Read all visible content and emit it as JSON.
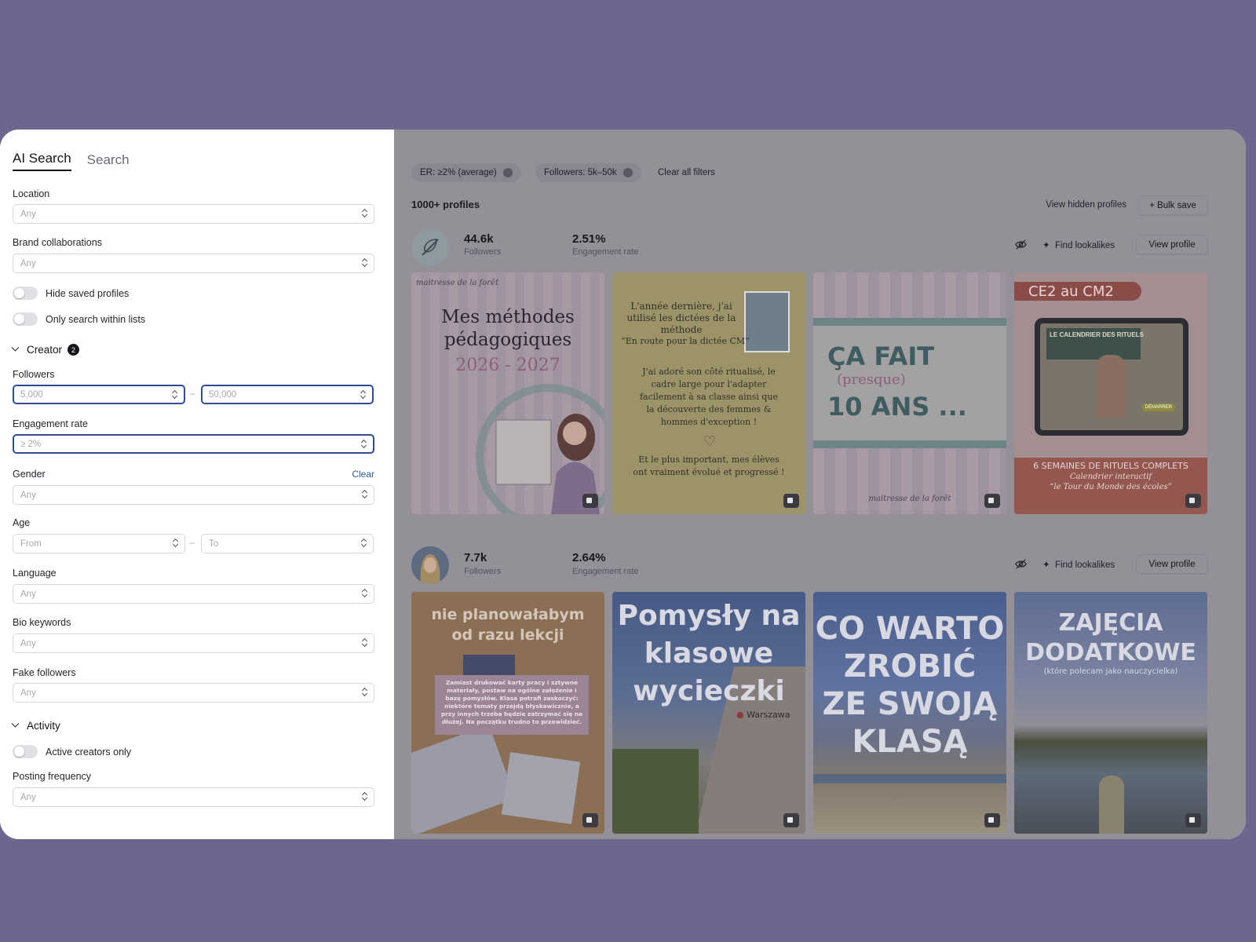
{
  "sidebar": {
    "tabs": [
      {
        "label": "AI Search",
        "active": true
      },
      {
        "label": "Search",
        "active": false
      }
    ],
    "location": {
      "label": "Location",
      "value": "Any"
    },
    "brand_collabs": {
      "label": "Brand collaborations",
      "value": "Any"
    },
    "hide_saved": {
      "label": "Hide saved profiles",
      "on": false
    },
    "only_lists": {
      "label": "Only search within lists",
      "on": false
    },
    "creator_section": {
      "label": "Creator",
      "badge": "2"
    },
    "followers": {
      "label": "Followers",
      "min": "5,000",
      "max": "50,000",
      "dash": "–"
    },
    "engagement": {
      "label": "Engagement rate",
      "value": "≥ 2%"
    },
    "gender": {
      "label": "Gender",
      "clear": "Clear",
      "value": "Any"
    },
    "age": {
      "label": "Age",
      "from": "From",
      "to": "To",
      "dash": "–"
    },
    "language": {
      "label": "Language",
      "value": "Any"
    },
    "bio": {
      "label": "Bio keywords",
      "value": "Any"
    },
    "fake": {
      "label": "Fake followers",
      "value": "Any"
    },
    "activity_section": {
      "label": "Activity"
    },
    "active_only": {
      "label": "Active creators only",
      "on": false
    },
    "posting": {
      "label": "Posting frequency",
      "value": "Any"
    }
  },
  "filters": {
    "chips": [
      "ER: ≥2% (average)",
      "Followers: 5k–50k"
    ],
    "clear_all": "Clear all filters"
  },
  "results": {
    "count": "1000+ profiles",
    "view_hidden": "View hidden profiles",
    "bulk_save": "+ Bulk save"
  },
  "profiles": [
    {
      "followers_value": "44.6k",
      "followers_label": "Followers",
      "er_value": "2.51%",
      "er_label": "Engagement rate",
      "find_lookalikes": "Find lookalikes",
      "view_profile": "View profile",
      "posts": [
        {
          "line1": "maitresse de la forêt",
          "line2": "Mes méthodes",
          "line3": "pédagogiques",
          "line4": "2026 - 2027"
        },
        {
          "line1": "L'année dernière, j'ai",
          "line2": "utilisé les dictées de la",
          "line3": "méthode",
          "line4": "“En route pour la dictée CM”",
          "line5": "J'ai adoré son côté ritualisé, le",
          "line6": "cadre large pour l'adapter",
          "line7": "facilement à sa classe ainsi que",
          "line8": "la découverte des femmes &",
          "line9": "hommes d'exception !",
          "line10": "Et le plus important, mes élèves",
          "line11": "ont vraiment évolué et progressé !"
        },
        {
          "line1": "ÇA FAIT",
          "line2": "(presque)",
          "line3": "10 ANS ...",
          "line4": "maitresse de la forêt"
        },
        {
          "line1": "CE2 au CM2",
          "line2": "LE CALENDRIER DES RITUELS",
          "line3": "6 SEMAINES DE RITUELS COMPLETS",
          "line4": "Calendrier interactif",
          "line5": "“le Tour du Monde des écoles”",
          "line6": "DÉMARRER"
        }
      ]
    },
    {
      "followers_value": "7.7k",
      "followers_label": "Followers",
      "er_value": "2.64%",
      "er_label": "Engagement rate",
      "find_lookalikes": "Find lookalikes",
      "view_profile": "View profile",
      "posts": [
        {
          "line1": "nie planowałabym",
          "line2": "od razu lekcji",
          "line3": "Zamiast drukować karty pracy i sztywne materiały, postaw na ogólne założenie i bazę pomysłów. Klasa potrafi zaskoczyć: niektóre tematy przejdą błyskawicznie, a przy innych trzeba będzie zatrzymać się na dłużej. Na początku trudno to przewidzieć."
        },
        {
          "line1": "Pomysły na",
          "line2": "klasowe",
          "line3": "wycieczki",
          "line4": "Warszawa"
        },
        {
          "line1": "CO WARTO",
          "line2": "ZROBIĆ",
          "line3": "ZE SWOJĄ",
          "line4": "KLASĄ"
        },
        {
          "line1": "ZAJĘCIA",
          "line2": "DODATKOWE",
          "line3": "(które polecam jako nauczycielka)"
        }
      ]
    }
  ]
}
